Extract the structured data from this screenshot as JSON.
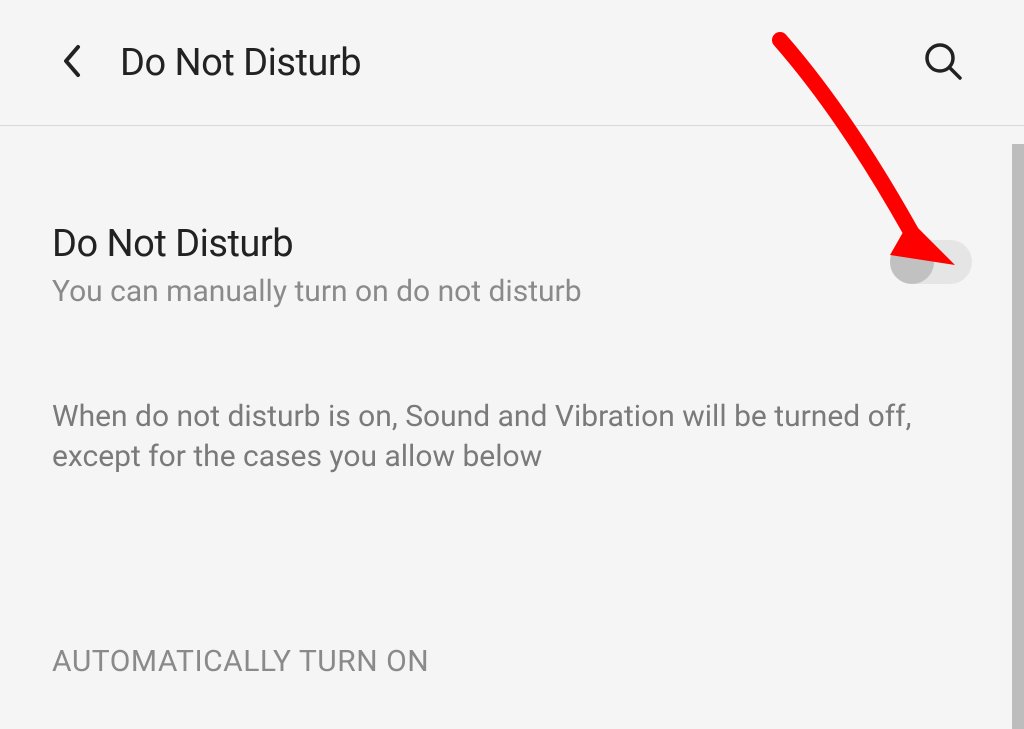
{
  "header": {
    "title": "Do Not Disturb"
  },
  "setting": {
    "title": "Do Not Disturb",
    "subtitle": "You can manually turn on do not disturb",
    "toggle_on": false
  },
  "description": "When do not disturb is on, Sound and Vibration will be turned off, except for the cases you allow below",
  "section_header": "AUTOMATICALLY TURN ON",
  "annotation": {
    "arrow_color": "#ff0000"
  }
}
